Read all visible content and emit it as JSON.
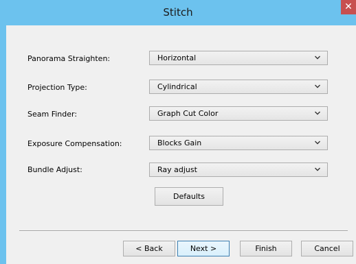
{
  "window": {
    "title": "Stitch",
    "close_glyph": "✕"
  },
  "fields": [
    {
      "label": "Panorama Straighten:",
      "value": "Horizontal"
    },
    {
      "label": "Projection Type:",
      "value": "Cylindrical"
    },
    {
      "label": "Seam Finder:",
      "value": "Graph Cut Color"
    },
    {
      "label": "Exposure Compensation:",
      "value": "Blocks Gain"
    },
    {
      "label": "Bundle Adjust:",
      "value": "Ray adjust"
    }
  ],
  "buttons": {
    "defaults": "Defaults",
    "back": "< Back",
    "next": "Next >",
    "finish": "Finish",
    "cancel": "Cancel"
  },
  "icons": {
    "close": "close-icon",
    "dropdown": "chevron-down-icon"
  },
  "colors": {
    "titlebar": "#6cc2ee",
    "close_button": "#c75050",
    "client": "#f0f0f0",
    "default_button_border": "#3c7fb1"
  }
}
